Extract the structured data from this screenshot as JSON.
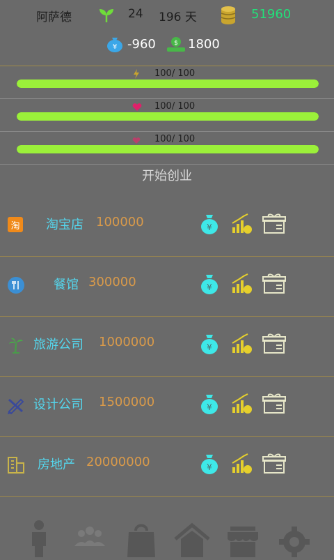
{
  "header": {
    "name": "阿萨德",
    "age": "24",
    "days": "196 天",
    "money": "51960",
    "debt": "-960",
    "income": "1800"
  },
  "stats": [
    {
      "text": "100/ 100",
      "icon": "lightning-icon",
      "fill": 1.0
    },
    {
      "text": "100/ 100",
      "icon": "heart-icon",
      "fill": 1.0
    },
    {
      "text": "100/ 100",
      "icon": "heart-small-icon",
      "fill": 1.0
    }
  ],
  "section_title": "开始创业",
  "businesses": [
    {
      "icon": "taobao-icon",
      "icon_text": "淘",
      "name": "淘宝店",
      "price": "100000"
    },
    {
      "icon": "restaurant-icon",
      "name": "餐馆",
      "price": "300000"
    },
    {
      "icon": "palm-tree-icon",
      "name": "旅游公司",
      "price": "1000000"
    },
    {
      "icon": "design-tools-icon",
      "name": "设计公司",
      "price": "1500000"
    },
    {
      "icon": "building-icon",
      "name": "房地产",
      "price": "20000000"
    }
  ],
  "nav": [
    {
      "icon": "person-icon"
    },
    {
      "icon": "people-icon"
    },
    {
      "icon": "shopping-bag-icon"
    },
    {
      "icon": "home-icon"
    },
    {
      "icon": "store-icon"
    },
    {
      "icon": "settings-gear-icon"
    }
  ],
  "colors": {
    "background": "#6a6a6a",
    "money": "#22e07a",
    "bar_fill": "#9bf03a",
    "biz_name": "#54d7ee",
    "biz_price": "#d99a4a"
  }
}
